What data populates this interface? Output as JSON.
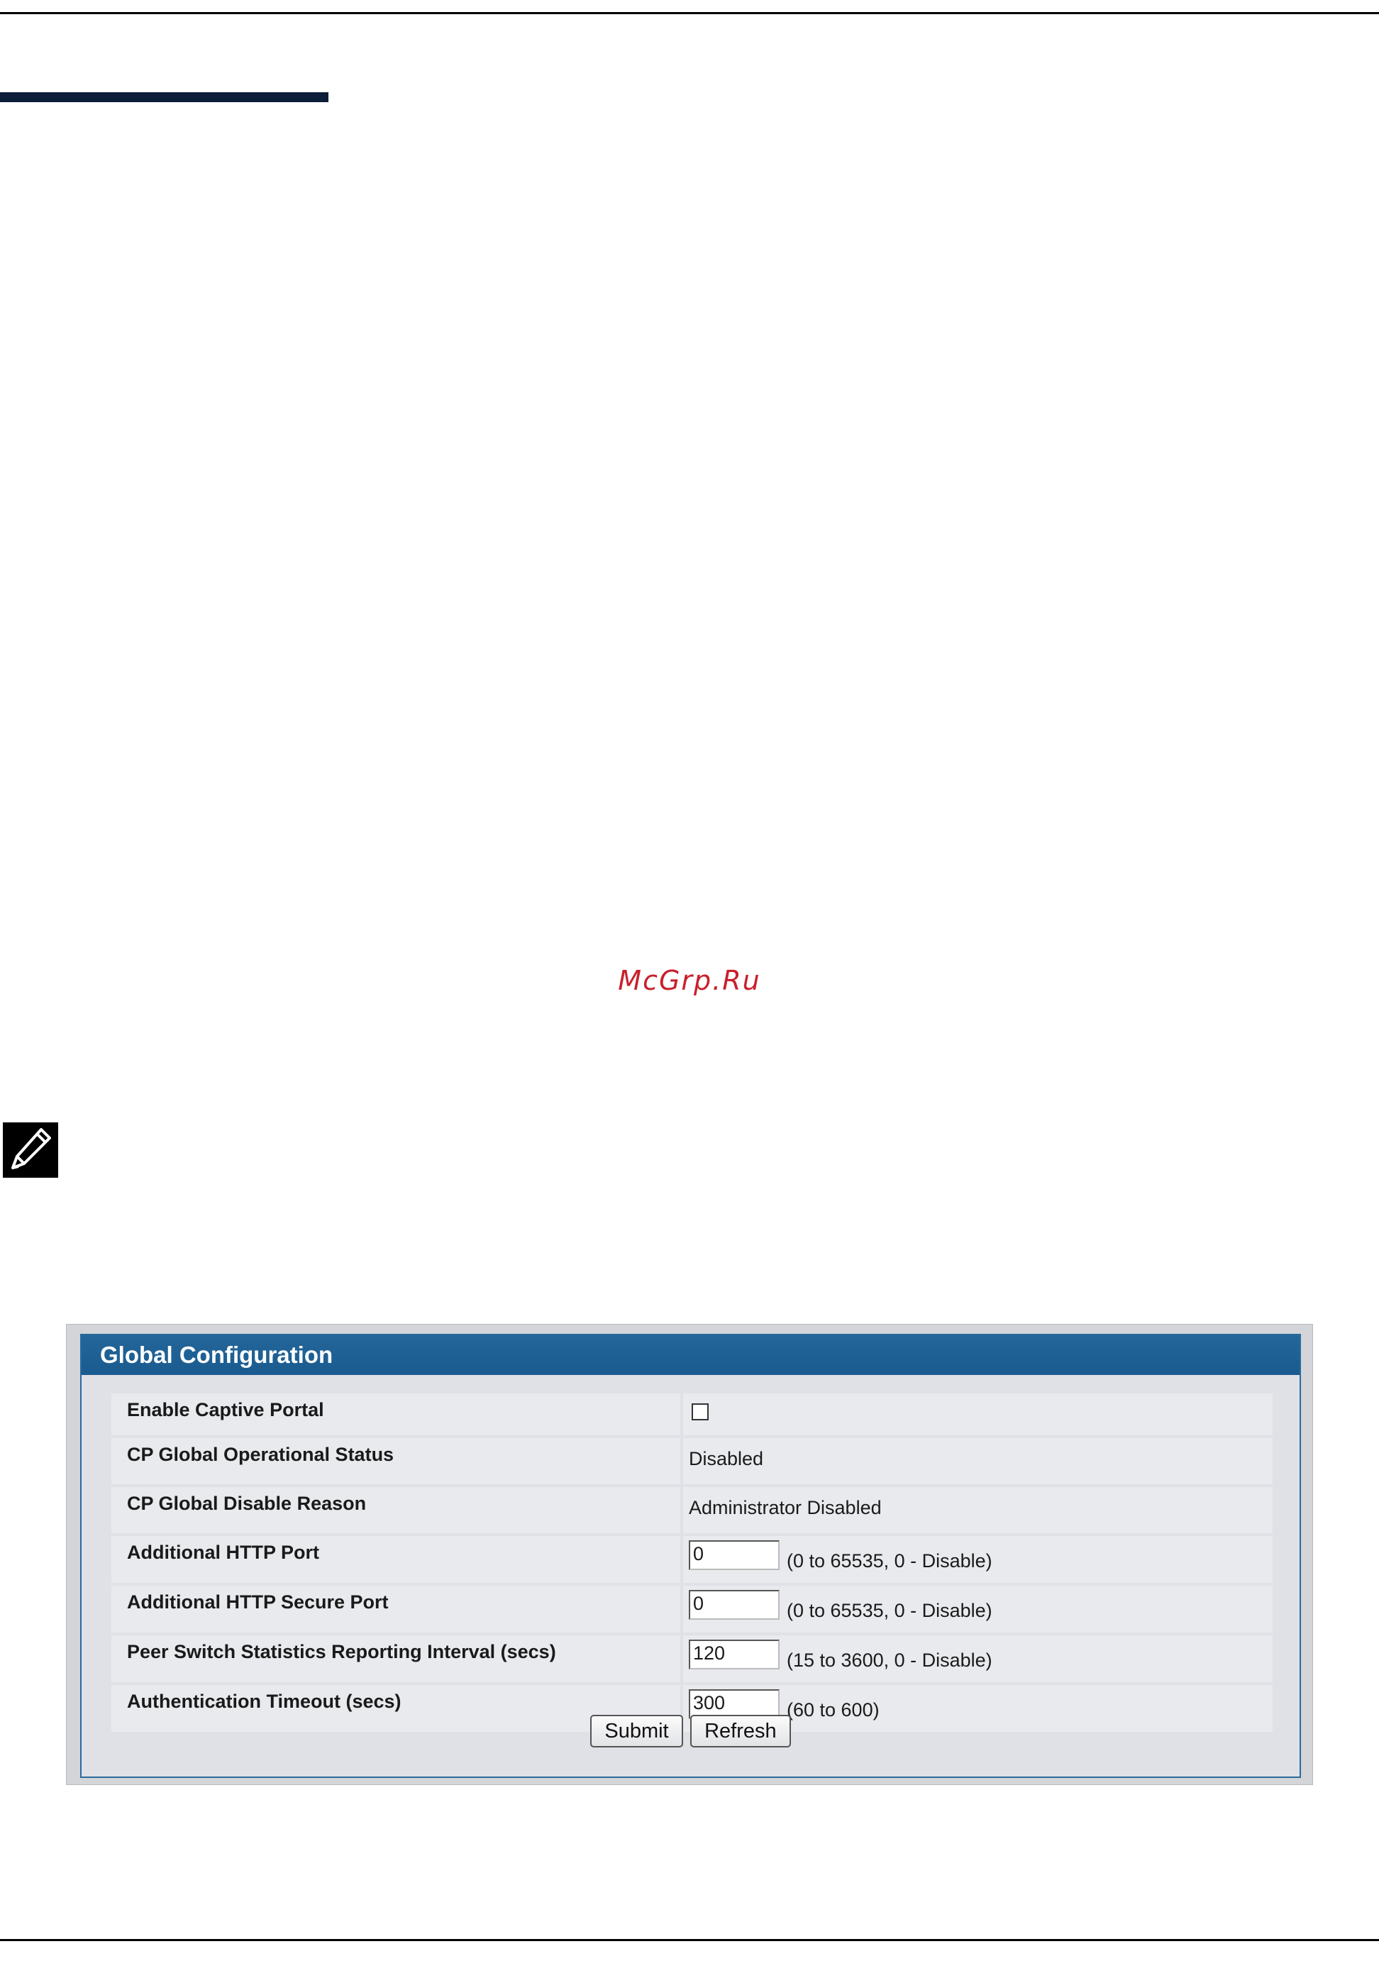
{
  "watermark": "McGrp.Ru",
  "panel": {
    "title": "Global Configuration",
    "rows": [
      {
        "label": "Enable Captive Portal",
        "type": "checkbox",
        "checked": false
      },
      {
        "label": "CP Global Operational Status",
        "type": "text",
        "value": "Disabled"
      },
      {
        "label": "CP Global Disable Reason",
        "type": "text",
        "value": "Administrator Disabled"
      },
      {
        "label": "Additional HTTP Port",
        "type": "input",
        "value": "0",
        "hint": "(0 to 65535, 0 - Disable)"
      },
      {
        "label": "Additional HTTP Secure Port",
        "type": "input",
        "value": "0",
        "hint": "(0 to 65535, 0 - Disable)"
      },
      {
        "label": "Peer Switch Statistics Reporting Interval (secs)",
        "type": "input",
        "value": "120",
        "hint": "(15 to 3600, 0 - Disable)"
      },
      {
        "label": "Authentication Timeout (secs)",
        "type": "input",
        "value": "300",
        "hint": "(60 to 600)"
      }
    ],
    "buttons": {
      "submit": "Submit",
      "refresh": "Refresh"
    }
  },
  "icons": {
    "note": "note-pencil-icon"
  },
  "colors": {
    "header": "#1a5b8f",
    "watermark": "#c8202c",
    "heading_bar": "#0d1e3a"
  }
}
